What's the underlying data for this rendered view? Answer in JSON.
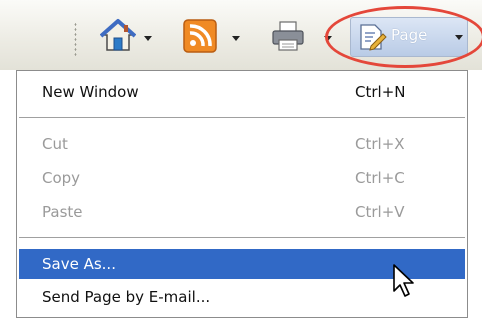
{
  "toolbar": {
    "buttons": [
      {
        "name": "home-icon",
        "has_dropdown": true
      },
      {
        "name": "rss-feed-icon",
        "has_dropdown": true
      },
      {
        "name": "printer-icon",
        "has_dropdown": true
      },
      {
        "name": "page-icon",
        "has_dropdown": true
      }
    ],
    "page_button_label": "Page",
    "highlight_color": "#e4473a"
  },
  "menu": {
    "items": [
      {
        "label": "New Window",
        "shortcut": "Ctrl+N",
        "disabled": false,
        "selected": false
      },
      {
        "label": "Cut",
        "shortcut": "Ctrl+X",
        "disabled": true,
        "selected": false
      },
      {
        "label": "Copy",
        "shortcut": "Ctrl+C",
        "disabled": true,
        "selected": false
      },
      {
        "label": "Paste",
        "shortcut": "Ctrl+V",
        "disabled": true,
        "selected": false
      },
      {
        "label": "Save As...",
        "shortcut": "",
        "disabled": false,
        "selected": true
      },
      {
        "label": "Send Page by E-mail...",
        "shortcut": "",
        "disabled": false,
        "selected": false
      }
    ],
    "selection_color": "#3169c6"
  }
}
